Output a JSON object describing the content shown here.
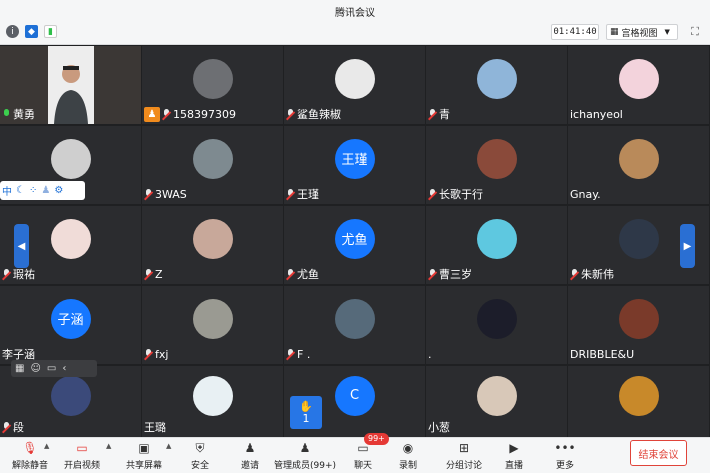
{
  "window": {
    "title": "腾讯会议"
  },
  "topbar": {
    "info_icon": "info-icon",
    "security_icon": "shield-icon",
    "network_icon": "signal-icon",
    "timer": "01:41:40",
    "view_label": "宫格视图",
    "fullscreen_icon": "fullscreen-icon"
  },
  "participants": [
    {
      "name": "黄勇",
      "mic": "on",
      "avatar": "video",
      "color": "#3a3a3a"
    },
    {
      "name": "158397309",
      "mic": "off",
      "avatar": "photo",
      "color": "#6d6f73",
      "host": true
    },
    {
      "name": "鲨鱼辣椒",
      "mic": "off",
      "avatar": "photo",
      "color": "#e9e9e9"
    },
    {
      "name": "青",
      "mic": "off",
      "avatar": "photo",
      "color": "#8fb5d9"
    },
    {
      "name": "ichanyeol",
      "mic": "none",
      "avatar": "photo",
      "color": "#f3d3dc"
    },
    {
      "name": "",
      "mic": "none",
      "avatar": "photo",
      "color": "#cfcfcf"
    },
    {
      "name": "3WAS",
      "mic": "off",
      "avatar": "photo",
      "color": "#7e8a90"
    },
    {
      "name": "王瑾",
      "mic": "off",
      "avatar": "text",
      "avatar_text": "王瑾",
      "color": "#1677ff"
    },
    {
      "name": "长歌于行",
      "mic": "off",
      "avatar": "photo",
      "color": "#8a4a3a"
    },
    {
      "name": "Gnay.",
      "mic": "none",
      "avatar": "photo",
      "color": "#b98a5a"
    },
    {
      "name": "瑕祐",
      "mic": "off",
      "avatar": "photo",
      "color": "#f0dcd8"
    },
    {
      "name": "Z",
      "mic": "off",
      "avatar": "photo",
      "color": "#c8a89a"
    },
    {
      "name": "尤鱼",
      "mic": "off",
      "avatar": "text",
      "avatar_text": "尤鱼",
      "color": "#1677ff"
    },
    {
      "name": "曹三岁",
      "mic": "off",
      "avatar": "photo",
      "color": "#5ec8e0"
    },
    {
      "name": "朱新伟",
      "mic": "off",
      "avatar": "photo",
      "color": "#2e3848"
    },
    {
      "name": "李子涵",
      "mic": "none",
      "avatar": "text",
      "avatar_text": "子涵",
      "color": "#1677ff"
    },
    {
      "name": "fxj",
      "mic": "off",
      "avatar": "photo",
      "color": "#9a9a92"
    },
    {
      "name": "F .",
      "mic": "off",
      "avatar": "photo",
      "color": "#566a7a"
    },
    {
      "name": ".",
      "mic": "none",
      "avatar": "photo",
      "color": "#1c1d2a"
    },
    {
      "name": "DRIBBLE&U",
      "mic": "none",
      "avatar": "photo",
      "color": "#7a3a2a"
    },
    {
      "name": "段",
      "mic": "off",
      "avatar": "photo",
      "color": "#3b4a7a"
    },
    {
      "name": "王璐",
      "mic": "none",
      "avatar": "photo",
      "color": "#e8f0f3"
    },
    {
      "name": "",
      "mic": "none",
      "avatar": "text",
      "avatar_text": "C",
      "color": "#1677ff"
    },
    {
      "name": "小葱",
      "mic": "none",
      "avatar": "photo",
      "color": "#d8c8b8"
    },
    {
      "name": "",
      "mic": "none",
      "avatar": "photo",
      "color": "#c8892a"
    }
  ],
  "floating": {
    "translate_label": "中",
    "handraise_count": "1"
  },
  "toolbar": {
    "items": [
      {
        "label": "解除静音",
        "icon": "mic-muted-icon"
      },
      {
        "label": "开启视频",
        "icon": "camera-off-icon"
      },
      {
        "label": "共享屏幕",
        "icon": "share-screen-icon"
      },
      {
        "label": "安全",
        "icon": "shield-icon"
      },
      {
        "label": "邀请",
        "icon": "invite-icon"
      },
      {
        "label": "管理成员(99+)",
        "icon": "members-icon"
      },
      {
        "label": "聊天",
        "icon": "chat-icon"
      },
      {
        "label": "录制",
        "icon": "record-icon"
      },
      {
        "label": "分组讨论",
        "icon": "breakout-icon"
      },
      {
        "label": "直播",
        "icon": "live-icon"
      },
      {
        "label": "更多",
        "icon": "more-icon"
      }
    ],
    "chat_badge": "99+",
    "end_label": "结束会议"
  }
}
